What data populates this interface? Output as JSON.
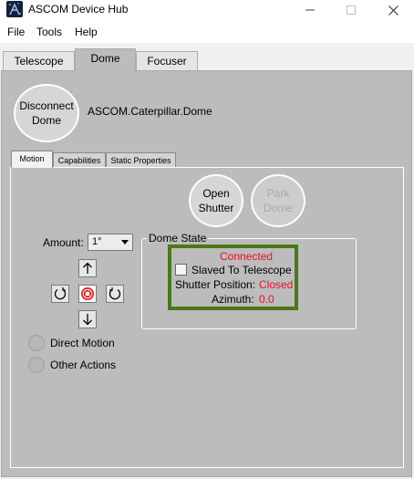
{
  "window": {
    "title": "ASCOM Device Hub",
    "minimize_icon": "minimize-icon",
    "maximize_icon": "maximize-icon",
    "close_icon": "close-icon"
  },
  "menu": {
    "items": [
      "File",
      "Tools",
      "Help"
    ]
  },
  "main_tabs": [
    {
      "label": "Telescope",
      "active": false
    },
    {
      "label": "Dome",
      "active": true
    },
    {
      "label": "Focuser",
      "active": false
    }
  ],
  "connection": {
    "button_label_line1": "Disconnect",
    "button_label_line2": "Dome",
    "device_name": "ASCOM.Caterpillar.Dome"
  },
  "sub_tabs": [
    {
      "label": "Motion",
      "active": true
    },
    {
      "label": "Capabilities",
      "active": false
    },
    {
      "label": "Static Properties",
      "active": false
    }
  ],
  "shutter_buttons": {
    "open_line1": "Open",
    "open_line2": "Shutter",
    "park_line1": "Park",
    "park_line2": "Dome",
    "park_enabled": false
  },
  "motion": {
    "amount_label": "Amount:",
    "amount_value": "1°",
    "up_icon": "arrow-up-icon",
    "down_icon": "arrow-down-icon",
    "rotate_ccw_icon": "rotate-ccw-icon",
    "rotate_cw_icon": "rotate-cw-icon",
    "stop_icon": "stop-icon"
  },
  "options": {
    "direct_motion": "Direct Motion",
    "other_actions": "Other Actions"
  },
  "dome_state": {
    "title": "Dome State",
    "status": "Connected",
    "slaved_label": "Slaved To Telescope",
    "slaved_checked": false,
    "shutter_label": "Shutter Position:",
    "shutter_value": "Closed",
    "azimuth_label": "Azimuth:",
    "azimuth_value": "0.0"
  },
  "colors": {
    "status_red": "#e81123",
    "highlight_green": "#4a7818",
    "panel_gray": "#bcbcbc"
  }
}
